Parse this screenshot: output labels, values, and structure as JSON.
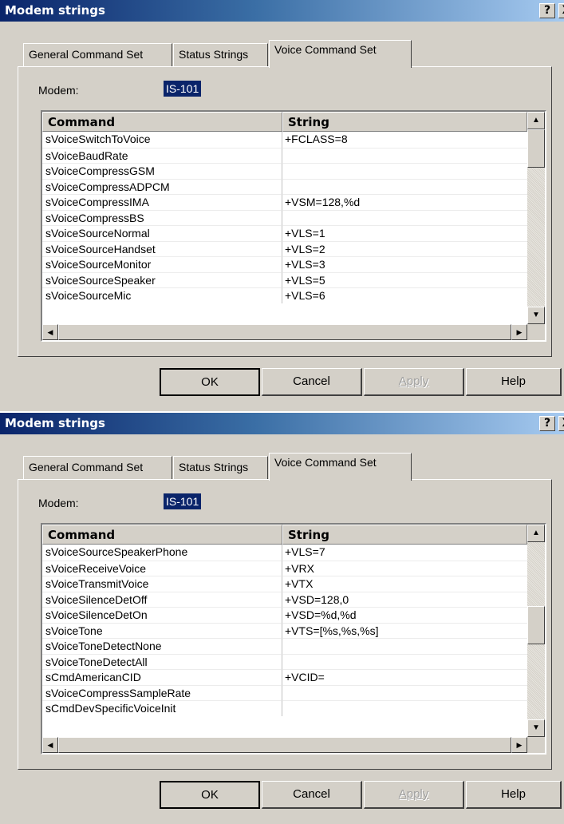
{
  "dialogs": [
    {
      "title": "Modem strings",
      "title_buttons": {
        "help": "?",
        "close": "X"
      },
      "tabs": [
        "General Command Set",
        "Status Strings",
        "Voice Command Set"
      ],
      "modem_label": "Modem:",
      "modem_value": "IS-101",
      "columns": {
        "command": "Command",
        "string": "String"
      },
      "rows": [
        {
          "command": "sVoiceSwitchToVoice",
          "string": "+FCLASS=8"
        },
        {
          "command": "sVoiceBaudRate",
          "string": ""
        },
        {
          "command": "sVoiceCompressGSM",
          "string": ""
        },
        {
          "command": "sVoiceCompressADPCM",
          "string": ""
        },
        {
          "command": "sVoiceCompressIMA",
          "string": "+VSM=128,%d"
        },
        {
          "command": "sVoiceCompressBS",
          "string": ""
        },
        {
          "command": "sVoiceSourceNormal",
          "string": "+VLS=1"
        },
        {
          "command": "sVoiceSourceHandset",
          "string": "+VLS=2"
        },
        {
          "command": "sVoiceSourceMonitor",
          "string": "+VLS=3"
        },
        {
          "command": "sVoiceSourceSpeaker",
          "string": "+VLS=5"
        },
        {
          "command": "sVoiceSourceMic",
          "string": "+VLS=6"
        }
      ],
      "buttons": {
        "ok": "OK",
        "cancel": "Cancel",
        "apply": "Apply",
        "help": "Help"
      }
    },
    {
      "title": "Modem strings",
      "title_buttons": {
        "help": "?",
        "close": "X"
      },
      "tabs": [
        "General Command Set",
        "Status Strings",
        "Voice Command Set"
      ],
      "modem_label": "Modem:",
      "modem_value": "IS-101",
      "columns": {
        "command": "Command",
        "string": "String"
      },
      "rows": [
        {
          "command": "sVoiceSourceSpeakerPhone",
          "string": "+VLS=7"
        },
        {
          "command": "sVoiceReceiveVoice",
          "string": "+VRX"
        },
        {
          "command": "sVoiceTransmitVoice",
          "string": "+VTX"
        },
        {
          "command": "sVoiceSilenceDetOff",
          "string": "+VSD=128,0"
        },
        {
          "command": "sVoiceSilenceDetOn",
          "string": "+VSD=%d,%d"
        },
        {
          "command": "sVoiceTone",
          "string": "+VTS=[%s,%s,%s]"
        },
        {
          "command": "sVoiceToneDetectNone",
          "string": ""
        },
        {
          "command": "sVoiceToneDetectAll",
          "string": ""
        },
        {
          "command": "sCmdAmericanCID",
          "string": "+VCID="
        },
        {
          "command": "sVoiceCompressSampleRate",
          "string": ""
        },
        {
          "command": "sCmdDevSpecificVoiceInit",
          "string": ""
        }
      ],
      "buttons": {
        "ok": "OK",
        "cancel": "Cancel",
        "apply": "Apply",
        "help": "Help"
      }
    }
  ],
  "colors": {
    "title_start": "#0a246a",
    "title_end": "#a6caf0",
    "face": "#d4d0c8",
    "selection": "#0a246a"
  },
  "icons": [
    "help-icon",
    "close-icon",
    "scroll-up-arrow-icon",
    "scroll-down-arrow-icon",
    "scroll-left-arrow-icon",
    "scroll-right-arrow-icon"
  ]
}
